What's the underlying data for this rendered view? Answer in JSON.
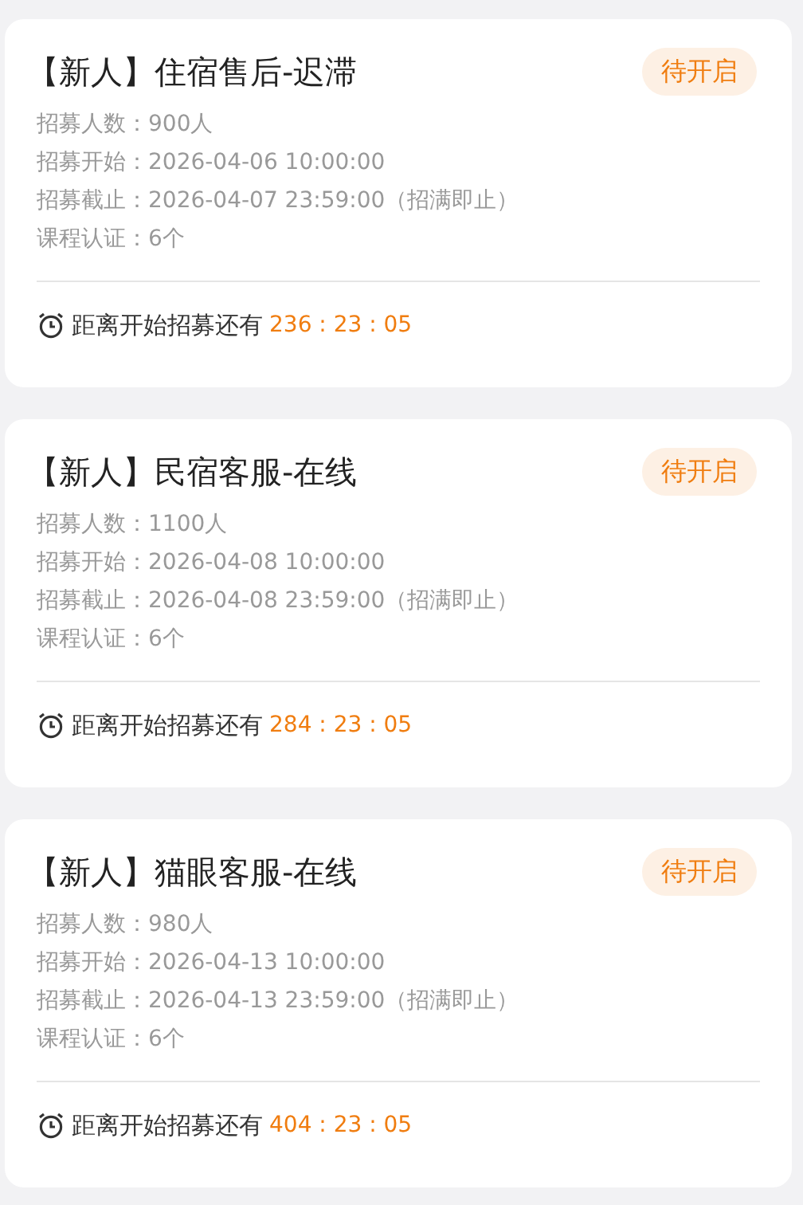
{
  "cards": [
    {
      "title": "【新人】住宿售后-迟滞",
      "status": "待开启",
      "lines": [
        "招募人数：900人",
        "招募开始：2026-04-06 10:00:00",
        "招募截止：2026-04-07 23:59:00（招满即止）",
        "课程认证：6个"
      ],
      "countdown_label": "距离开始招募还有",
      "countdown": "236 : 23 : 05"
    },
    {
      "title": "【新人】民宿客服-在线",
      "status": "待开启",
      "lines": [
        "招募人数：1100人",
        "招募开始：2026-04-08 10:00:00",
        "招募截止：2026-04-08 23:59:00（招满即止）",
        "课程认证：6个"
      ],
      "countdown_label": "距离开始招募还有",
      "countdown": "284 : 23 : 05"
    },
    {
      "title": "【新人】猫眼客服-在线",
      "status": "待开启",
      "lines": [
        "招募人数：980人",
        "招募开始：2026-04-13 10:00:00",
        "招募截止：2026-04-13 23:59:00（招满即止）",
        "课程认证：6个"
      ],
      "countdown_label": "距离开始招募还有",
      "countdown": "404 : 23 : 05"
    }
  ]
}
